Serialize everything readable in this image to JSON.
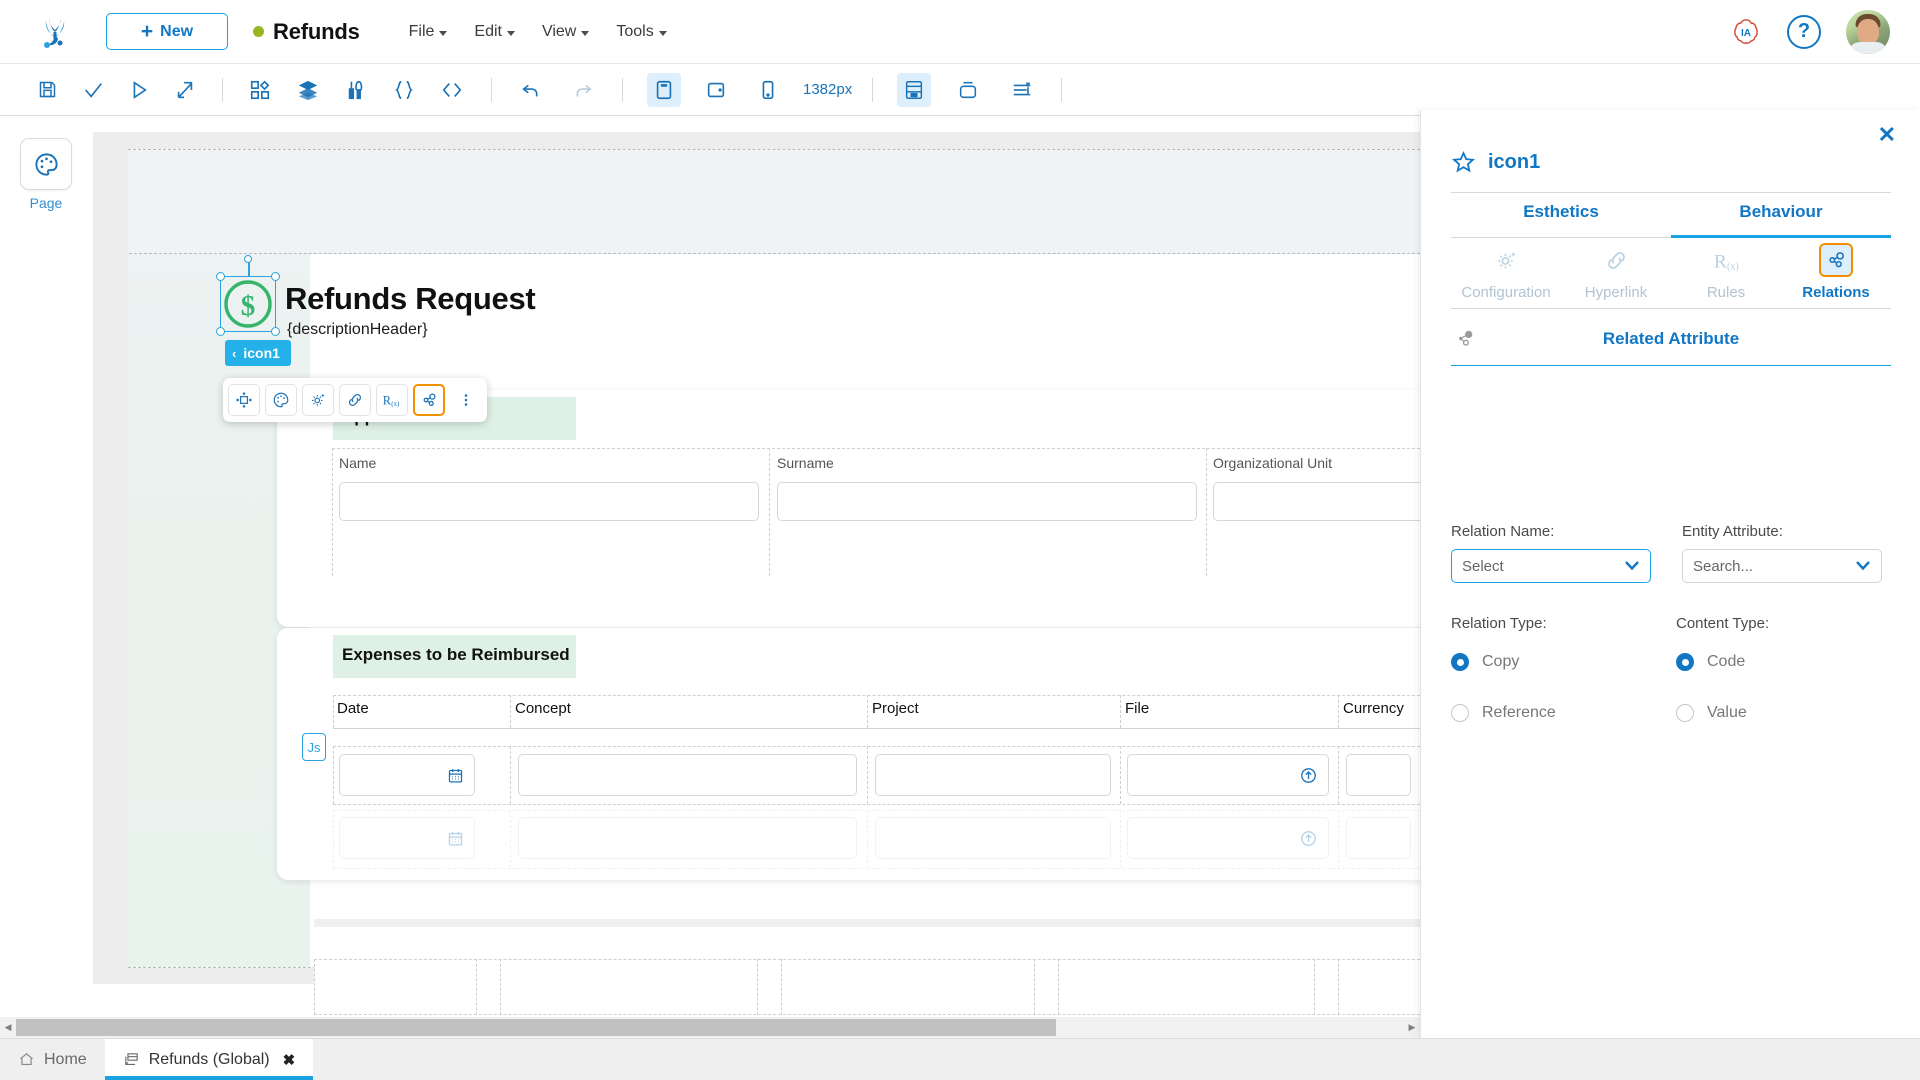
{
  "topbar": {
    "logo_icon": "frog-logo-icon",
    "new_button": "New",
    "project_name": "Refunds",
    "menus": [
      "File",
      "Edit",
      "View",
      "Tools"
    ],
    "ia_badge": "IA",
    "help_icon": "?",
    "avatar_icon": "user-avatar"
  },
  "toolbar": {
    "groups": [
      {
        "items": [
          {
            "name": "save-icon",
            "state": "enabled"
          },
          {
            "name": "validate-check-icon",
            "state": "enabled"
          },
          {
            "name": "run-play-icon",
            "state": "enabled"
          },
          {
            "name": "deploy-export-icon",
            "state": "enabled"
          }
        ]
      },
      {
        "items": [
          {
            "name": "components-grid-icon",
            "state": "enabled"
          },
          {
            "name": "layers-stack-icon",
            "state": "enabled"
          },
          {
            "name": "tools-pen-icon",
            "state": "enabled"
          },
          {
            "name": "braces-icon",
            "state": "enabled"
          },
          {
            "name": "code-tags-icon",
            "state": "enabled"
          }
        ]
      },
      {
        "items": [
          {
            "name": "undo-icon",
            "state": "enabled"
          },
          {
            "name": "redo-icon",
            "state": "disabled"
          }
        ]
      },
      {
        "items": [
          {
            "name": "desktop-preview-icon",
            "state": "active"
          },
          {
            "name": "tablet-preview-icon",
            "state": "enabled"
          },
          {
            "name": "mobile-preview-icon",
            "state": "enabled"
          }
        ]
      },
      {
        "items": []
      },
      {
        "items": [
          {
            "name": "panel-layout-icon",
            "state": "active"
          },
          {
            "name": "container-icon",
            "state": "enabled"
          },
          {
            "name": "align-distribute-icon",
            "state": "enabled"
          }
        ]
      }
    ],
    "zoom_value": "1382px"
  },
  "left_rail": {
    "page_button_icon": "palette-icon",
    "page_label": "Page"
  },
  "canvas": {
    "header": {
      "icon": "dollar-circle-icon",
      "title": "Refunds Request",
      "subtitle": "{descriptionHeader}",
      "selection_tag": "icon1",
      "selection_tag_chevron": "‹"
    },
    "float_toolbar": [
      {
        "name": "move-resize-icon",
        "selected": false
      },
      {
        "name": "palette-icon",
        "selected": false
      },
      {
        "name": "configuration-gear-sparkle-icon",
        "selected": false
      },
      {
        "name": "hyperlink-chain-icon",
        "selected": false
      },
      {
        "name": "rules-rx-icon",
        "selected": false
      },
      {
        "name": "relations-icon",
        "selected": true
      },
      {
        "name": "more-vertical-icon",
        "selected": false
      }
    ],
    "applicant_card": {
      "title": "Applicant Details",
      "fields": [
        "Name",
        "Surname",
        "Organizational Unit"
      ]
    },
    "expenses_card": {
      "title": "Expenses to be Reimbursed",
      "columns": [
        "Date",
        "Concept",
        "Project",
        "File",
        "Currency"
      ],
      "js_tag": "Js",
      "row_icons": {
        "date": "calendar-icon",
        "file": "upload-circle-icon"
      },
      "row_count": 2
    }
  },
  "scrollbar": {
    "left_arrow": "◀",
    "right_arrow": "▶"
  },
  "right_panel": {
    "close_label": "✕",
    "star_icon": "star-icon",
    "title": "icon1",
    "tabs": [
      {
        "label": "Esthetics",
        "active": false
      },
      {
        "label": "Behaviour",
        "active": true
      }
    ],
    "subtabs": [
      {
        "label": "Configuration",
        "icon": "configuration-gear-sparkle-icon",
        "active": false
      },
      {
        "label": "Hyperlink",
        "icon": "hyperlink-chain-icon",
        "active": false
      },
      {
        "label": "Rules",
        "icon": "rules-rx-icon",
        "active": false
      },
      {
        "label": "Relations",
        "icon": "relations-icon",
        "active": true
      }
    ],
    "section": {
      "icon": "relations-small-icon",
      "label": "Related Attribute"
    },
    "relation_name": {
      "label": "Relation Name:",
      "value": "Select"
    },
    "entity_attribute": {
      "label": "Entity Attribute:",
      "value": "Search..."
    },
    "relation_type": {
      "label": "Relation Type:",
      "options": [
        {
          "label": "Copy",
          "selected": true
        },
        {
          "label": "Reference",
          "selected": false
        }
      ]
    },
    "content_type": {
      "label": "Content Type:",
      "options": [
        {
          "label": "Code",
          "selected": true
        },
        {
          "label": "Value",
          "selected": false
        }
      ]
    }
  },
  "bottom_tabs": [
    {
      "label": "Home",
      "icon": "home-icon",
      "active": false,
      "closable": false
    },
    {
      "label": "Refunds (Global)",
      "icon": "form-icon",
      "active": true,
      "closable": true,
      "close_label": "✖"
    }
  ],
  "colors": {
    "accent_blue": "#18a4e0",
    "link_blue": "#1177c4",
    "selection_orange": "#f29000",
    "status_green": "#97b61f",
    "card_title_green": "#dff1e6",
    "icon_green": "#34b56b"
  }
}
